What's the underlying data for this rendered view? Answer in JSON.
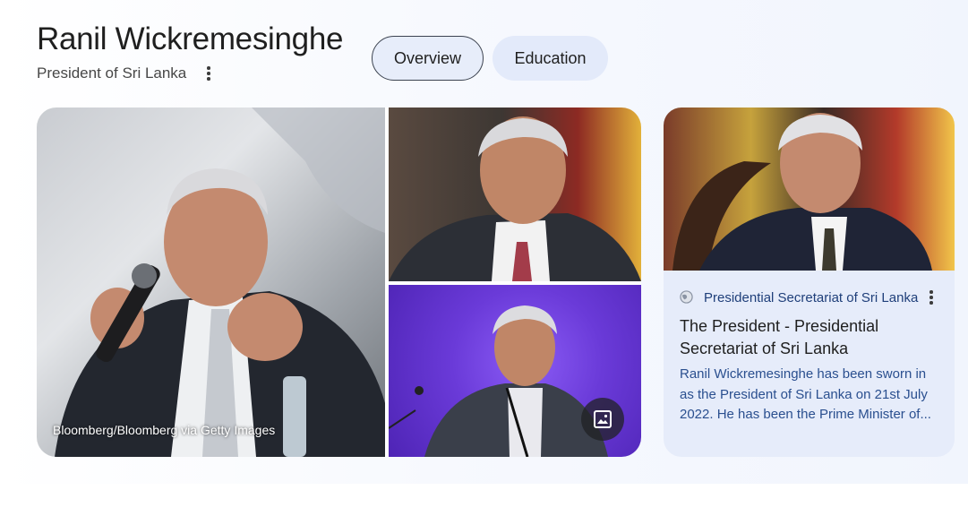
{
  "header": {
    "title": "Ranil Wickremesinghe",
    "subtitle": "President of Sri Lanka"
  },
  "tabs": [
    {
      "label": "Overview",
      "selected": true
    },
    {
      "label": "Education",
      "selected": false
    }
  ],
  "gallery": {
    "credit": "Bloomberg/Bloomberg via Getty Images",
    "images_button_icon": "image-icon"
  },
  "source_card": {
    "source_icon": "globe-icon",
    "source": "Presidential Secretariat of Sri Lanka",
    "title": "The President - Presidential Secretariat of Sri Lanka",
    "snippet": "Ranil Wickremesinghe has been sworn in as the President of Sri Lanka on 21st July 2022. He has been the Prime Minister of..."
  },
  "colors": {
    "tab_selected_bg": "#e7edfa",
    "tab_bg": "#e3eafa",
    "card_bg": "#e6ecfa",
    "link_text": "#2a4f8f"
  }
}
